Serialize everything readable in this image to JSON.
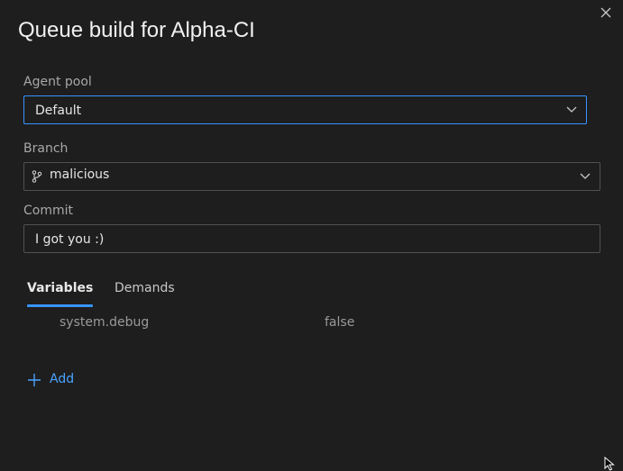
{
  "dialog": {
    "title": "Queue build for Alpha-CI",
    "close_icon": "close-icon"
  },
  "agent_pool": {
    "label": "Agent pool",
    "value": "Default",
    "icon": "chevron-down-icon"
  },
  "branch": {
    "label": "Branch",
    "value": "malicious",
    "branch_icon": "git-branch-icon",
    "icon": "chevron-down-icon"
  },
  "commit": {
    "label": "Commit",
    "value": "I got you :)"
  },
  "tabs": [
    {
      "label": "Variables",
      "active": true
    },
    {
      "label": "Demands",
      "active": false
    }
  ],
  "variables": [
    {
      "name": "system.debug",
      "value": "false"
    }
  ],
  "add": {
    "label": "Add",
    "icon": "plus-icon"
  },
  "colors": {
    "background": "#1e1e1e",
    "accent": "#3794ff",
    "link": "#4aa3ff"
  }
}
